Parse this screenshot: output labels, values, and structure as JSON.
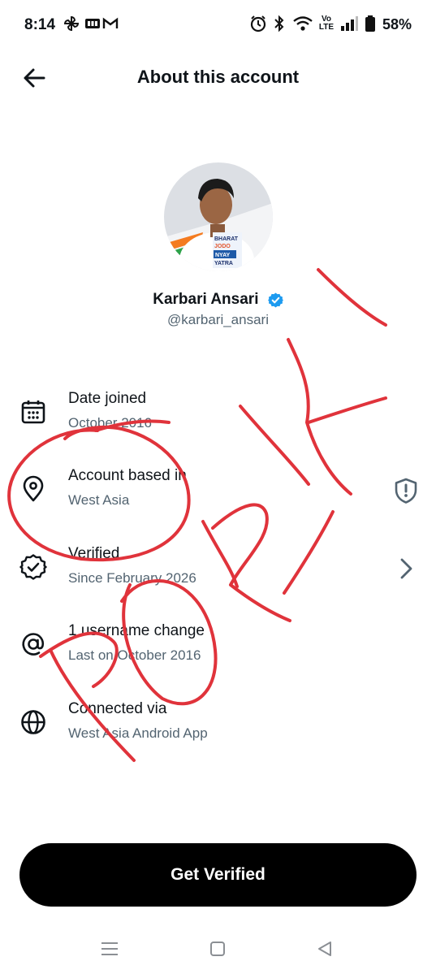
{
  "status_bar": {
    "time": "8:14",
    "battery": "58%",
    "network_label": "Vo LTE"
  },
  "header": {
    "title": "About this account"
  },
  "profile": {
    "name": "Karbari Ansari",
    "handle": "@karbari_ansari",
    "shirt_text": "BHARAT JODO NYAY YATRA"
  },
  "rows": [
    {
      "title": "Date joined",
      "subtitle": "October 2016",
      "icon": "calendar-icon"
    },
    {
      "title": "Account based in",
      "subtitle": "West Asia",
      "icon": "location-pin-icon",
      "trailing_icon": "shield-alert-icon"
    },
    {
      "title": "Verified",
      "subtitle": "Since February 2026",
      "icon": "verified-check-icon",
      "trailing_icon": "chevron-right-icon"
    },
    {
      "title": "1 username change",
      "subtitle": "Last on October 2016",
      "icon": "at-sign-icon"
    },
    {
      "title": "Connected via",
      "subtitle": "West Asia Android App",
      "icon": "globe-icon"
    }
  ],
  "cta": {
    "label": "Get Verified"
  },
  "annotation_colors": {
    "scribble": "#e0333b"
  },
  "colors": {
    "verified_badge": "#1d9bf0",
    "secondary_text": "#536471",
    "primary_text": "#0f1419"
  }
}
